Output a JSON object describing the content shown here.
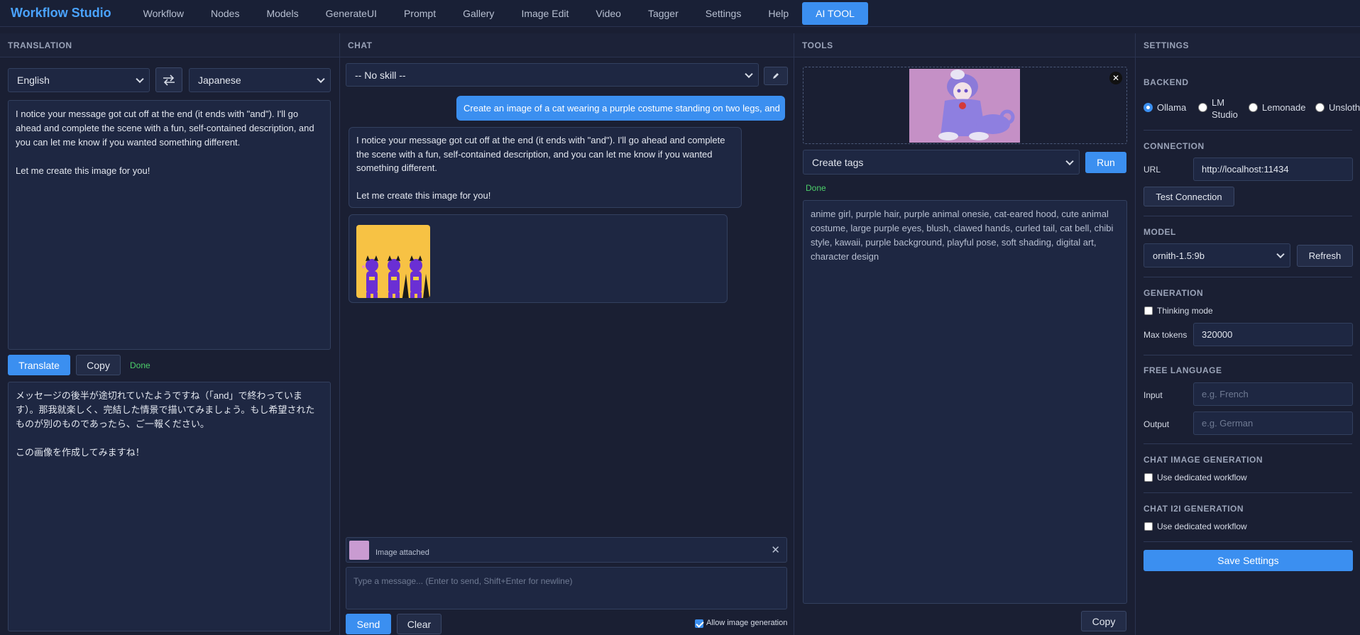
{
  "app": {
    "title": "Workflow Studio"
  },
  "nav": {
    "items": [
      {
        "label": "Workflow"
      },
      {
        "label": "Nodes"
      },
      {
        "label": "Models"
      },
      {
        "label": "GenerateUI"
      },
      {
        "label": "Prompt"
      },
      {
        "label": "Gallery"
      },
      {
        "label": "Image Edit"
      },
      {
        "label": "Video"
      },
      {
        "label": "Tagger"
      },
      {
        "label": "Settings"
      },
      {
        "label": "Help"
      },
      {
        "label": "AI TOOL"
      }
    ]
  },
  "translation": {
    "header": "TRANSLATION",
    "source_lang": "English",
    "target_lang": "Japanese",
    "source_text": "I notice your message got cut off at the end (it ends with \"and\"). I'll go ahead and complete the scene with a fun, self-contained description, and you can let me know if you wanted something different.\n\nLet me create this image for you!",
    "translate_label": "Translate",
    "copy_label": "Copy",
    "status": "Done",
    "output_text": "メッセージの後半が途切れていたようですね（「and」で終わっています）。那我就楽しく、完結した情景で描いてみましょう。もし希望されたものが別のものであったら、ご一報ください。\n\nこの画像を作成してみますね！"
  },
  "chat": {
    "header": "CHAT",
    "skill": "-- No skill --",
    "user_message": "Create an image of a cat wearing a purple costume standing on two legs, and",
    "bot_message": "I notice your message got cut off at the end (it ends with \"and\"). I'll go ahead and complete the scene with a fun, self-contained description, and you can let me know if you wanted something different.\n\nLet me create this image for you!",
    "attachment_label": "Image attached",
    "input_placeholder": "Type a message... (Enter to send, Shift+Enter for newline)",
    "send_label": "Send",
    "clear_label": "Clear",
    "allow_image_label": "Allow image generation"
  },
  "tools": {
    "header": "TOOLS",
    "mode": "Create tags",
    "run_label": "Run",
    "status": "Done",
    "output_text": "anime girl, purple hair, purple animal onesie, cat-eared hood, cute animal costume, large purple eyes, blush, clawed hands, curled tail, cat bell, chibi style, kawaii, purple background, playful pose, soft shading, digital art, character design",
    "copy_label": "Copy"
  },
  "settings": {
    "header": "SETTINGS",
    "backend_title": "BACKEND",
    "backends": [
      {
        "label": "Ollama",
        "selected": true
      },
      {
        "label": "LM Studio",
        "selected": false
      },
      {
        "label": "Lemonade",
        "selected": false
      },
      {
        "label": "Unsloth",
        "selected": false
      }
    ],
    "connection_title": "CONNECTION",
    "url_label": "URL",
    "url_value": "http://localhost:11434",
    "test_label": "Test Connection",
    "model_title": "MODEL",
    "model_value": "ornith-1.5:9b",
    "refresh_label": "Refresh",
    "generation_title": "GENERATION",
    "thinking_label": "Thinking mode",
    "max_tokens_label": "Max tokens",
    "max_tokens_value": "320000",
    "free_lang_title": "FREE LANGUAGE",
    "input_label": "Input",
    "input_placeholder": "e.g. French",
    "output_label": "Output",
    "output_placeholder": "e.g. German",
    "chat_img_title": "CHAT IMAGE GENERATION",
    "chat_img_check": "Use dedicated workflow",
    "chat_i2i_title": "CHAT I2I GENERATION",
    "chat_i2i_check": "Use dedicated workflow",
    "save_label": "Save Settings"
  },
  "colors": {
    "accent": "#3b8ff0",
    "bg": "#1a1f33",
    "done": "#4ccf6a"
  }
}
